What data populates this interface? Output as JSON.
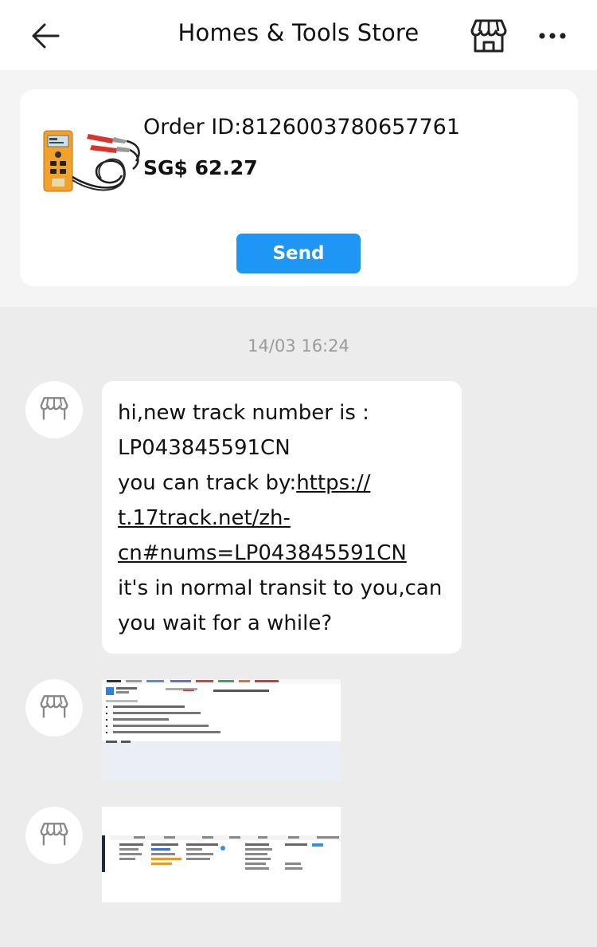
{
  "header": {
    "title": "Homes & Tools Store",
    "back_icon": "arrow-left-icon",
    "store_icon": "storefront-icon",
    "more_icon": "more-dots-icon"
  },
  "order": {
    "id_text": "Order ID:8126003780657761",
    "price": "SG$ 62.27",
    "send_label": "Send",
    "send_color": "#1e96f5"
  },
  "chat": {
    "timestamp": "14/03 16:24",
    "message": {
      "line1": "hi,new track number is :",
      "line2": "LP043845591CN",
      "line3_prefix": "you can track by:",
      "link_part1": "https://",
      "link_part2": "t.17track.net/zh-",
      "link_part3": "cn#nums=LP043845591CN",
      "line4": "it's in normal transit to you,can",
      "line5": "you wait for a while?"
    },
    "images": [
      {
        "type": "screenshot-image"
      },
      {
        "type": "screenshot-image"
      }
    ]
  }
}
